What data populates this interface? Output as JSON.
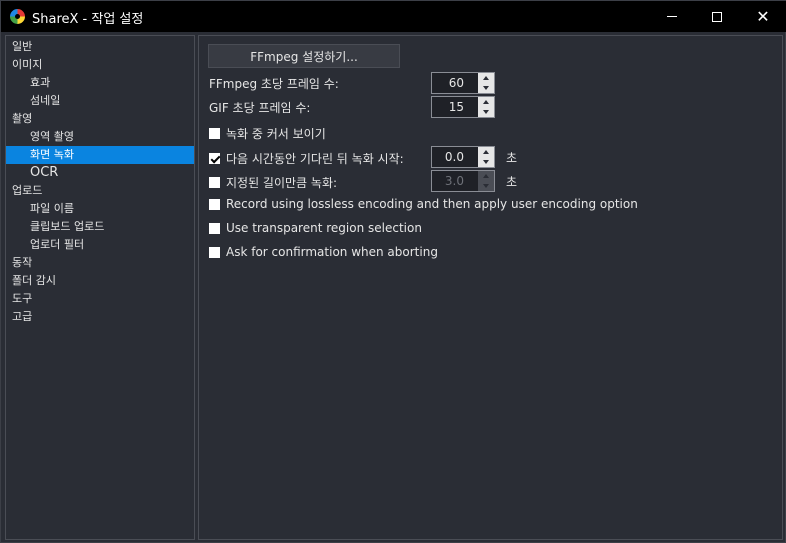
{
  "window": {
    "title": "ShareX - 작업 설정",
    "minimize_glyph": "",
    "close_glyph": "✕"
  },
  "sidebar": {
    "items": [
      {
        "label": "일반",
        "indent": 0
      },
      {
        "label": "이미지",
        "indent": 0
      },
      {
        "label": "효과",
        "indent": 1
      },
      {
        "label": "섬네일",
        "indent": 1
      },
      {
        "label": "촬영",
        "indent": 0
      },
      {
        "label": "영역 촬영",
        "indent": 1
      },
      {
        "label": "화면 녹화",
        "indent": 1,
        "selected": true
      },
      {
        "label": "OCR",
        "indent": 1
      },
      {
        "label": "업로드",
        "indent": 0
      },
      {
        "label": "파일 이름",
        "indent": 1
      },
      {
        "label": "클립보드 업로드",
        "indent": 1
      },
      {
        "label": "업로더 필터",
        "indent": 1
      },
      {
        "label": "동작",
        "indent": 0
      },
      {
        "label": "폴더 감시",
        "indent": 0
      },
      {
        "label": "도구",
        "indent": 0
      },
      {
        "label": "고급",
        "indent": 0
      }
    ]
  },
  "main": {
    "ffmpeg_button": "FFmpeg 설정하기...",
    "ffmpeg_fps_label": "FFmpeg 초당 프레임 수:",
    "ffmpeg_fps_value": "60",
    "gif_fps_label": "GIF 초당 프레임 수:",
    "gif_fps_value": "15",
    "show_cursor": {
      "label": "녹화 중 커서 보이기",
      "checked": false
    },
    "delay_start": {
      "label": "다음 시간동안 기다린 뒤 녹화 시작:",
      "checked": true,
      "value": "0.0",
      "unit": "초"
    },
    "fixed_duration": {
      "label": "지정된 길이만큼 녹화:",
      "checked": false,
      "value": "3.0",
      "unit": "초"
    },
    "lossless": {
      "label": "Record using lossless encoding and then apply user encoding option",
      "checked": false
    },
    "transparent": {
      "label": "Use transparent region selection",
      "checked": false
    },
    "confirm_abort": {
      "label": "Ask for confirmation when aborting",
      "checked": false
    }
  },
  "colors": {
    "background": "#2a2d35",
    "selection": "#0a84e0",
    "titlebar": "#000000"
  }
}
